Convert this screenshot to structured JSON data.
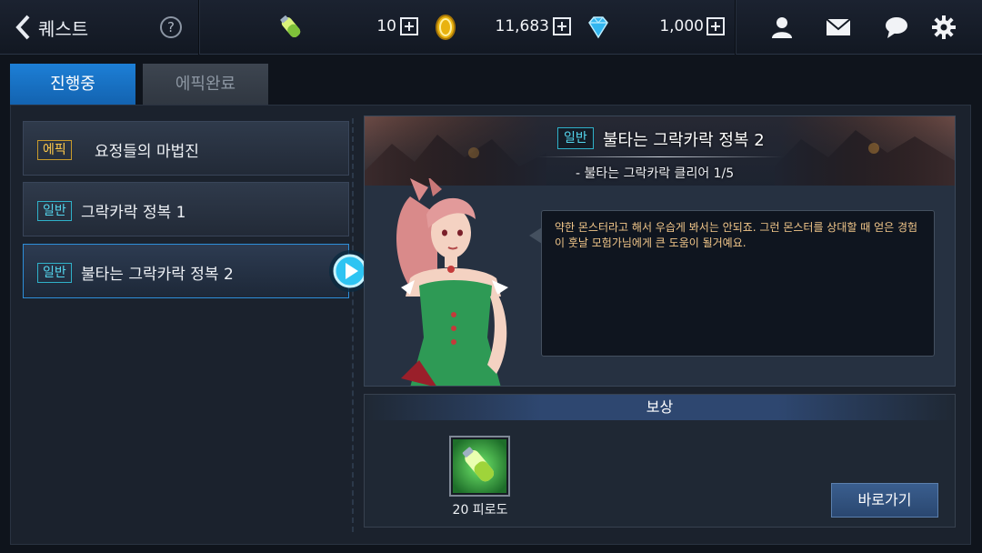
{
  "header": {
    "title": "퀘스트",
    "help_symbol": "?",
    "resources": [
      {
        "icon": "fatigue-potion-icon",
        "value": "10"
      },
      {
        "icon": "gold-coin-icon",
        "value": "11,683"
      },
      {
        "icon": "diamond-icon",
        "value": "1,000"
      }
    ],
    "actions": [
      "friends-icon",
      "mail-icon",
      "chat-icon",
      "settings-gear-icon"
    ]
  },
  "tabs": {
    "active": "진행중",
    "inactive": "에픽완료"
  },
  "quests": [
    {
      "type": "에픽",
      "name": "요정들의 마법진"
    },
    {
      "type": "일반",
      "name": "그락카락 정복 1"
    },
    {
      "type": "일반",
      "name": "불타는 그락카락 정복 2",
      "selected": true
    }
  ],
  "detail": {
    "type": "일반",
    "title": "불타는 그락카락 정복 2",
    "objective": "- 불타는 그락카락 클리어 1/5",
    "dialog": "약한 몬스터라고 해서 우습게 봐서는 안되죠. 그런 몬스터를 상대할 때 얻은 경험이 훗날 모험가님에게 큰 도움이 될거예요."
  },
  "reward": {
    "header": "보상",
    "item_label": "20 피로도",
    "item_icon": "fatigue-potion-icon",
    "go_button": "바로가기"
  },
  "colors": {
    "accent_blue": "#1d7fd6",
    "epic_gold": "#ffc94a",
    "normal_cyan": "#54d6ee",
    "dialog_text": "#f2c78a"
  }
}
